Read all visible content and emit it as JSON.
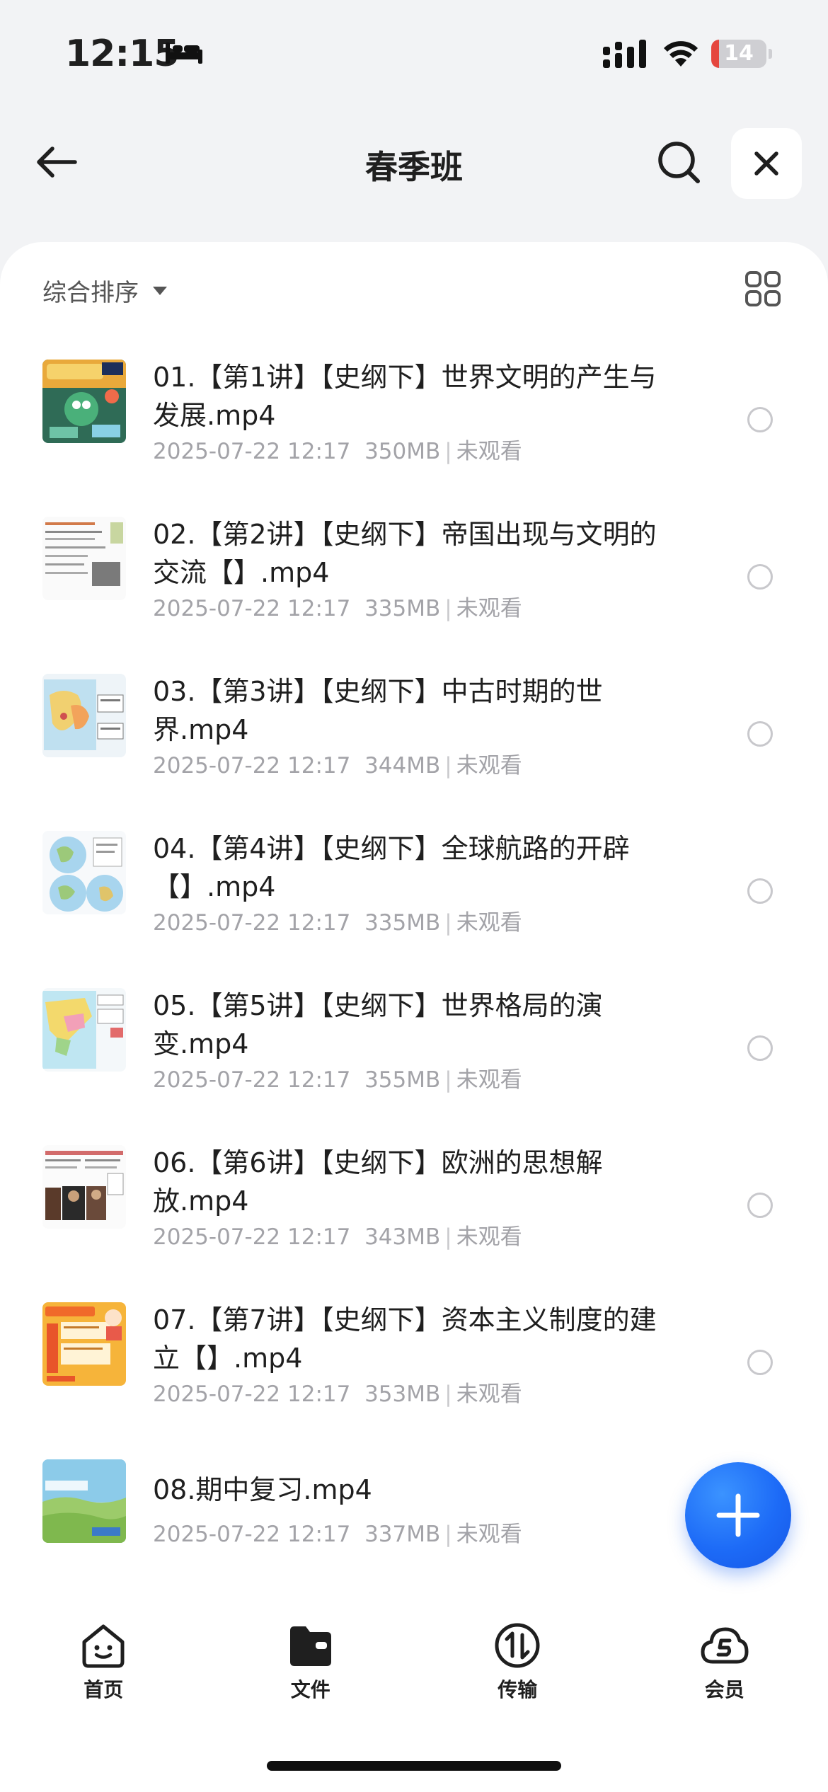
{
  "status_bar": {
    "time": "12:15",
    "battery": "14",
    "battery_level": 0.14
  },
  "nav": {
    "title": "春季班"
  },
  "sort": {
    "label": "综合排序"
  },
  "files": [
    {
      "name": "01.【第1讲】【史纲下】世界文明的产生与发展.mp4",
      "date": "2025-07-22 12:17",
      "size": "350MB",
      "status": "未观看",
      "thumb": "cartoon-poster"
    },
    {
      "name": "02.【第2讲】【史纲下】帝国出现与文明的交流【】.mp4",
      "date": "2025-07-22 12:17",
      "size": "335MB",
      "status": "未观看",
      "thumb": "document-page"
    },
    {
      "name": "03.【第3讲】【史纲下】中古时期的世界.mp4",
      "date": "2025-07-22 12:17",
      "size": "344MB",
      "status": "未观看",
      "thumb": "map-page"
    },
    {
      "name": "04.【第4讲】【史纲下】全球航路的开辟【】.mp4",
      "date": "2025-07-22 12:17",
      "size": "335MB",
      "status": "未观看",
      "thumb": "globe-page"
    },
    {
      "name": "05.【第5讲】【史纲下】世界格局的演变.mp4",
      "date": "2025-07-22 12:17",
      "size": "355MB",
      "status": "未观看",
      "thumb": "asia-map-page"
    },
    {
      "name": "06.【第6讲】【史纲下】欧洲的思想解放.mp4",
      "date": "2025-07-22 12:17",
      "size": "343MB",
      "status": "未观看",
      "thumb": "portrait-page"
    },
    {
      "name": "07.【第7讲】【史纲下】资本主义制度的建立【】.mp4",
      "date": "2025-07-22 12:17",
      "size": "353MB",
      "status": "未观看",
      "thumb": "orange-slide"
    },
    {
      "name": "08.期中复习.mp4",
      "date": "2025-07-22 12:17",
      "size": "337MB",
      "status": "未观看",
      "thumb": "landscape-poster"
    }
  ],
  "tabs": [
    {
      "label": "首页",
      "icon": "home-smile-icon"
    },
    {
      "label": "文件",
      "icon": "folder-icon"
    },
    {
      "label": "传输",
      "icon": "transfer-icon"
    },
    {
      "label": "会员",
      "icon": "vip-cloud-icon"
    }
  ],
  "colors": {
    "accent": "#1d6bf7",
    "battery_low": "#e5463e"
  }
}
